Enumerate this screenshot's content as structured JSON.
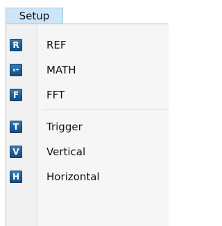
{
  "menubar": {
    "menu_title": "Setup"
  },
  "dropdown": {
    "group1": [
      {
        "label": "REF",
        "icon_letter": "R",
        "icon": "ref-icon"
      },
      {
        "label": "MATH",
        "icon_letter": "x÷",
        "icon": "math-icon"
      },
      {
        "label": "FFT",
        "icon_letter": "F",
        "icon": "fft-icon"
      }
    ],
    "group2": [
      {
        "label": "Trigger",
        "icon_letter": "T",
        "icon": "trigger-icon"
      },
      {
        "label": "Vertical",
        "icon_letter": "V",
        "icon": "vertical-icon"
      },
      {
        "label": "Horizontal",
        "icon_letter": "H",
        "icon": "horizontal-icon"
      }
    ]
  },
  "colors": {
    "menu_highlight": "#cde6f7",
    "icon_blue": "#1f5f96"
  }
}
